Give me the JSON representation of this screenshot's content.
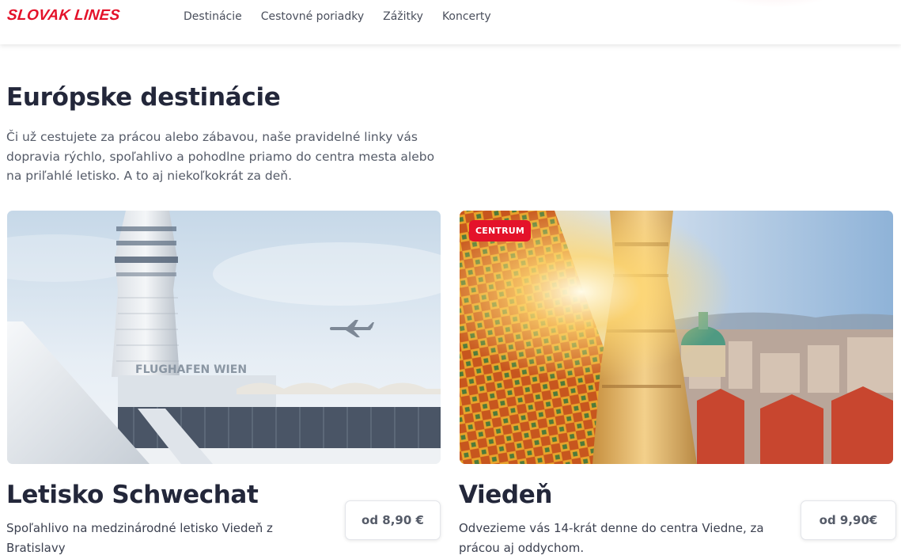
{
  "brand": {
    "logo_text": "SLOVAK LINES",
    "accent_color": "#e4122a"
  },
  "nav": {
    "items": [
      {
        "label": "Destinácie"
      },
      {
        "label": "Cestovné poriadky"
      },
      {
        "label": "Zážitky"
      },
      {
        "label": "Koncerty"
      }
    ]
  },
  "main": {
    "title": "Európske destinácie",
    "intro": "Či už cestujete za prácou alebo zábavou, naše pravidelné linky vás dopravia rýchlo, spoľahlivo a pohodlne priamo do centra mesta alebo na priľahlé letisko. A to aj niekoľkokrát za deň."
  },
  "cards": [
    {
      "title": "Letisko Schwechat",
      "description": "Spoľahlivo na medzinárodné letisko Viedeň z Bratislavy",
      "price": "od 8,90 €",
      "image_text": "FLUGHAFEN WIEN"
    },
    {
      "title": "Viedeň",
      "description": "Odvezieme vás 14-krát denne do centra Viedne, za prácou aj oddychom.",
      "price": "od 9,90€",
      "badge": "CENTRUM"
    }
  ]
}
